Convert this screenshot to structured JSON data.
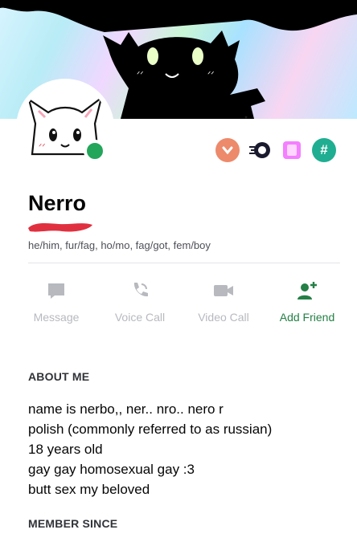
{
  "profile": {
    "username": "Nerro",
    "pronouns": "he/him, fur/fag, ho/mo, fag/got, fem/boy",
    "status": "online",
    "status_color": "#23a55a"
  },
  "badges": [
    {
      "name": "chevron-badge-icon",
      "color": "#ec8a6b"
    },
    {
      "name": "nitro-badge-icon",
      "color": "#4e5d94"
    },
    {
      "name": "hypesquad-badge-icon",
      "color": "#f47fff"
    },
    {
      "name": "hashtag-badge-icon",
      "color": "#1fae91"
    }
  ],
  "actions": [
    {
      "label": "Message",
      "icon": "message-icon",
      "enabled": false
    },
    {
      "label": "Voice Call",
      "icon": "phone-icon",
      "enabled": false
    },
    {
      "label": "Video Call",
      "icon": "video-camera-icon",
      "enabled": false
    },
    {
      "label": "Add Friend",
      "icon": "add-friend-icon",
      "enabled": true
    }
  ],
  "about": {
    "title": "ABOUT ME",
    "lines": [
      "name is nerbo,, ner.. nro.. nero r",
      "polish (commonly referred to as russian)",
      "18 years old",
      "gay gay homosexual gay :3",
      "butt sex my beloved"
    ]
  },
  "member_since": {
    "title": "MEMBER SINCE"
  },
  "colors": {
    "accent_green": "#248046",
    "muted_icon": "#b7b9bf",
    "redaction": "#e0303f"
  }
}
